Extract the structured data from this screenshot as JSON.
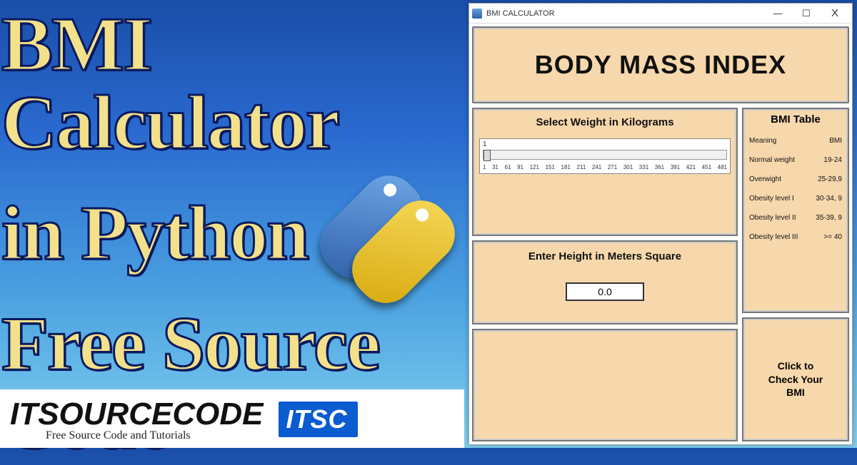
{
  "promo": {
    "line1": "BMI Calculator",
    "line2": "in Python",
    "line3": "Free Source Code"
  },
  "brand": {
    "name": "ITSOURCECODE",
    "tag": "Free Source Code and Tutorials",
    "badge": "ITSC"
  },
  "window": {
    "title": "BMI CALCULATOR",
    "min": "—",
    "max": "☐",
    "close": "X"
  },
  "app": {
    "heading": "BODY MASS INDEX",
    "weight_label": "Select Weight in Kilograms",
    "weight_value": "1",
    "ticks": [
      "1",
      "31",
      "61",
      "91",
      "121",
      "151",
      "181",
      "211",
      "241",
      "271",
      "301",
      "331",
      "361",
      "391",
      "421",
      "451",
      "481"
    ],
    "height_label": "Enter Height in Meters Square",
    "height_value": "0.0",
    "table_title": "BMI Table",
    "table": [
      {
        "k": "Meaning",
        "v": "BMI"
      },
      {
        "k": "Normal weight",
        "v": "19-24"
      },
      {
        "k": "Overwight",
        "v": "25-29,9"
      },
      {
        "k": "Obesity level I",
        "v": "30-34, 9"
      },
      {
        "k": "Obesity level II",
        "v": "35-39, 9"
      },
      {
        "k": "Obesity level III",
        "v": ">= 40"
      }
    ],
    "button": "Click to\nCheck Your\nBMI"
  }
}
